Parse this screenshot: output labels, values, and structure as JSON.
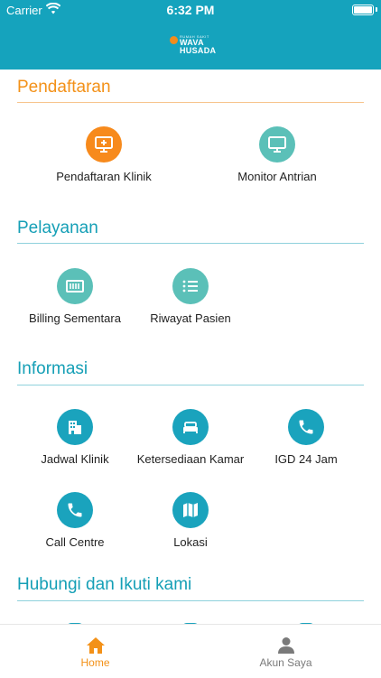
{
  "status_bar": {
    "carrier": "Carrier",
    "time": "6:32 PM"
  },
  "header": {
    "logo_small": "RUMAH SAKIT",
    "logo_line1": "WAVA",
    "logo_line2": "HUSADA"
  },
  "sections": {
    "pendaftaran": {
      "title": "Pendaftaran",
      "items": [
        {
          "label": "Pendaftaran Klinik",
          "icon": "monitor-plus-icon"
        },
        {
          "label": "Monitor Antrian",
          "icon": "monitor-icon"
        }
      ]
    },
    "pelayanan": {
      "title": "Pelayanan",
      "items": [
        {
          "label": "Billing Sementara",
          "icon": "billing-icon"
        },
        {
          "label": "Riwayat Pasien",
          "icon": "list-icon"
        }
      ]
    },
    "informasi": {
      "title": "Informasi",
      "items": [
        {
          "label": "Jadwal Klinik",
          "icon": "building-icon"
        },
        {
          "label": "Ketersediaan Kamar",
          "icon": "bed-icon"
        },
        {
          "label": "IGD 24 Jam",
          "icon": "phone-icon"
        },
        {
          "label": "Call Centre",
          "icon": "phone-icon"
        },
        {
          "label": "Lokasi",
          "icon": "map-icon"
        }
      ]
    },
    "hubungi": {
      "title": "Hubungi dan Ikuti kami"
    }
  },
  "tabbar": {
    "home": {
      "label": "Home",
      "icon": "home-icon",
      "color": "#f39118"
    },
    "account": {
      "label": "Akun Saya",
      "icon": "person-icon",
      "color": "#7a7a7a"
    }
  },
  "colors": {
    "header": "#15a3bd",
    "accent_orange": "#f39118",
    "accent_teal": "#159fb6"
  }
}
